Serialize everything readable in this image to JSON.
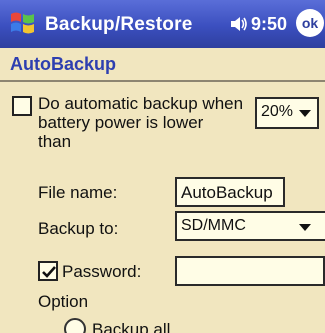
{
  "titlebar": {
    "title": "Backup/Restore",
    "time": "9:50",
    "ok_label": "ok"
  },
  "heading": "AutoBackup",
  "auto_backup": {
    "line1": "Do automatic backup when",
    "line2": "battery power is lower",
    "line3": "than",
    "checked": false,
    "threshold": "20%"
  },
  "file_name": {
    "label": "File name:",
    "value": "AutoBackup"
  },
  "backup_to": {
    "label": "Backup to:",
    "value": "SD/MMC"
  },
  "password": {
    "label": "Password:",
    "checked": true,
    "value": ""
  },
  "option": {
    "label": "Option",
    "radio_label": "Backup all"
  },
  "colors": {
    "titlebar": "#3b4fbf",
    "heading": "#2e3fb0",
    "background": "#f1e6bf"
  }
}
